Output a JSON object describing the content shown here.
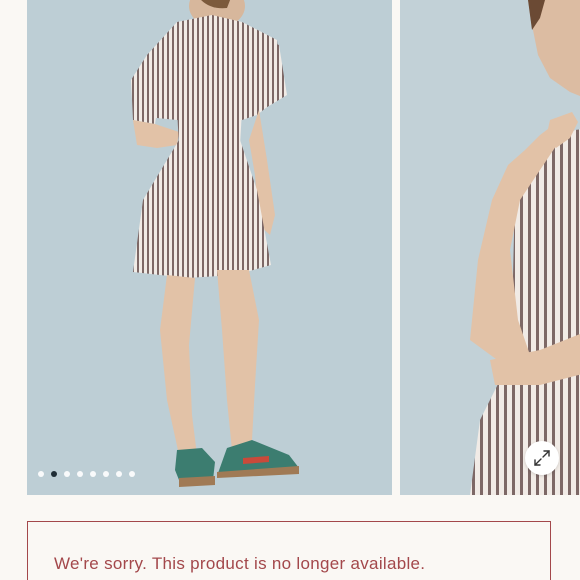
{
  "gallery": {
    "slide_count": 8,
    "active_index": 1,
    "images": [
      {
        "icon": "model-back-view-image"
      },
      {
        "icon": "model-front-closeup-image"
      }
    ],
    "expand_icon": "expand-arrows-icon"
  },
  "notice": {
    "message": "We're sorry. This product is no longer available."
  },
  "colors": {
    "background": "#faf8f4",
    "photo_backdrop": "#bfcfd6",
    "notice_accent": "#a3484b",
    "active_dot": "#1f2d36"
  }
}
